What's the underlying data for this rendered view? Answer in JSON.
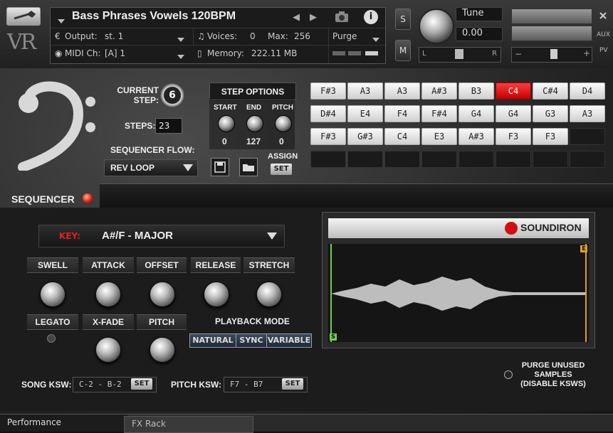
{
  "header": {
    "instrument_title": "Bass Phrases Vowels 120BPM",
    "output_label": "Output:",
    "output_value": "st. 1",
    "voices_label": "Voices:",
    "voices_value": "0",
    "max_label": "Max:",
    "max_value": "256",
    "purge_label": "Purge",
    "midi_label": "MIDI Ch:",
    "midi_value": "[A]  1",
    "memory_label": "Memory:",
    "memory_value": "222.11 MB",
    "s_button": "S",
    "m_button": "M",
    "tune_label": "Tune",
    "tune_value": "0.00",
    "pan_left": "L",
    "pan_right": "R",
    "aux_label": "AUX",
    "pv_label": "PV",
    "minus": "−",
    "plus": "+",
    "logo_text": "VR"
  },
  "sequencer": {
    "current_step_label": "CURRENT\nSTEP:",
    "current_step_value": "6",
    "steps_label": "STEPS:",
    "steps_value": "23",
    "flow_label": "SEQUENCER FLOW:",
    "flow_value": "REV LOOP",
    "section_label": "SEQUENCER",
    "step_options_title": "STEP OPTIONS",
    "start_label": "START",
    "start_value": "0",
    "end_label": "END",
    "end_value": "127",
    "pitch_label": "PITCH",
    "pitch_value": "0",
    "assign_label": "ASSIGN",
    "assign_set": "SET",
    "steps": [
      {
        "note": "F#3"
      },
      {
        "note": "A3"
      },
      {
        "note": "A3"
      },
      {
        "note": "A#3"
      },
      {
        "note": "B3"
      },
      {
        "note": "C4",
        "active": true
      },
      {
        "note": "C#4"
      },
      {
        "note": "D4"
      },
      {
        "note": "D#4"
      },
      {
        "note": "E4"
      },
      {
        "note": "F4"
      },
      {
        "note": "F#4"
      },
      {
        "note": "G4"
      },
      {
        "note": "G4"
      },
      {
        "note": "G3"
      },
      {
        "note": "A3"
      },
      {
        "note": "F#3"
      },
      {
        "note": "G#3"
      },
      {
        "note": "C4"
      },
      {
        "note": "E3"
      },
      {
        "note": "A#3"
      },
      {
        "note": "F3"
      },
      {
        "note": "F3"
      },
      {
        "note": ""
      },
      {
        "note": ""
      },
      {
        "note": ""
      },
      {
        "note": ""
      },
      {
        "note": ""
      },
      {
        "note": ""
      },
      {
        "note": ""
      },
      {
        "note": ""
      },
      {
        "note": ""
      }
    ]
  },
  "key": {
    "label": "KEY:",
    "value": "A#/F - MAJOR"
  },
  "params": {
    "swell": "SWELL",
    "attack": "ATTACK",
    "offset": "OFFSET",
    "release": "RELEASE",
    "stretch": "STRETCH",
    "legato": "LEGATO",
    "xfade": "X-FADE",
    "pitch": "PITCH",
    "playback_mode_label": "PLAYBACK MODE",
    "playback_modes": [
      "NATURAL",
      "SYNC",
      "VARIABLE"
    ]
  },
  "ksw": {
    "song_label": "SONG KSW:",
    "song_value": "C-2 - B-2",
    "pitch_label": "PITCH KSW:",
    "pitch_value": "F7 - B7",
    "set": "SET"
  },
  "waveform": {
    "brand": "SOUNDIRON",
    "start_marker": "S",
    "end_marker": "E"
  },
  "purge": {
    "label_line1": "PURGE UNUSED",
    "label_line2": "SAMPLES",
    "label_line3": "(DISABLE KSWS)"
  },
  "footer": {
    "performance_tab": "Performance",
    "fxrack_tab": "FX Rack"
  },
  "colors": {
    "active_step": "#e00000",
    "waveform": "#e8e8e8",
    "marker_start": "#6dd24a",
    "marker_end": "#e0a020"
  }
}
